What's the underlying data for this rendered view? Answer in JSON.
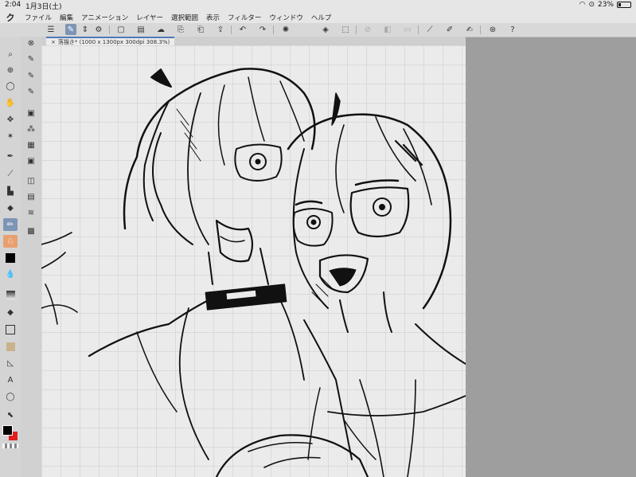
{
  "status": {
    "time": "2:04",
    "date": "1月3日(土)",
    "battery": "23%",
    "battery_level": 0.23
  },
  "menu": {
    "items": [
      "ファイル",
      "編集",
      "アニメーション",
      "レイヤー",
      "選択範囲",
      "表示",
      "フィルター",
      "ウィンドウ",
      "ヘルプ"
    ]
  },
  "tab": {
    "title": "落描き* (1000 x 1300px 300dpi 308.3%)"
  },
  "colors": {
    "accent": "#4f79b8",
    "tool_active": "#7d95b5",
    "main_color": "#000000",
    "sub_color": "#e02020",
    "tan_swatch": "#c8b48c"
  },
  "icons": {
    "menu_logo": "clip-studio-logo-icon",
    "tools": [
      "magnifier-icon",
      "zoom-icon",
      "lasso-icon",
      "hand-icon",
      "move-icon",
      "magic-wand-icon",
      "pen-icon",
      "eyedropper-icon",
      "fill-icon",
      "eraser-icon",
      "pencil-icon",
      "rabbit-icon",
      "black-square-icon",
      "water-drop-icon",
      "gradient-icon",
      "bucket-icon",
      "square-icon",
      "tan-square-icon",
      "figure-icon",
      "text-icon",
      "balloon-icon",
      "select-arrow-icon"
    ]
  }
}
